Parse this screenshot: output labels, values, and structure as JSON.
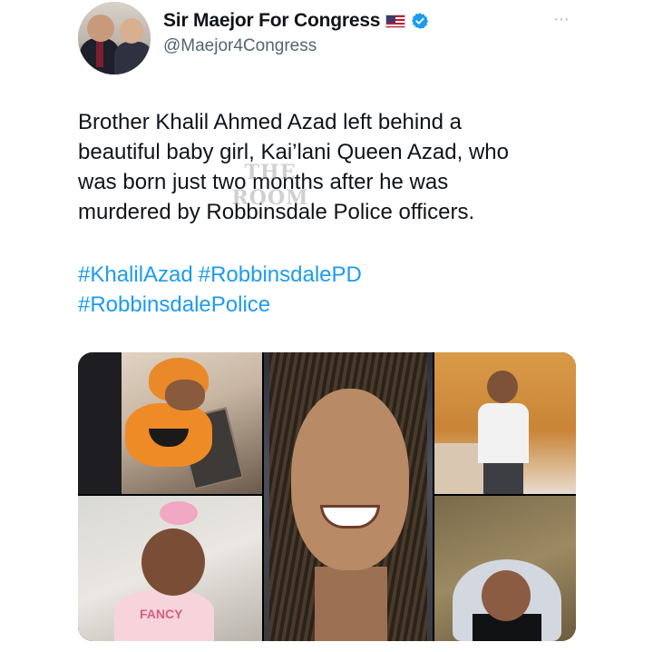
{
  "tweet": {
    "author": {
      "display_name": "Sir Maejor For Congress",
      "handle": "@Maejor4Congress",
      "flag_icon": "us-flag-icon",
      "verified_icon": "verified-badge-icon",
      "verified_color": "#1d9bf0"
    },
    "more_label": "···",
    "text": "Brother Khalil Ahmed Azad left behind a beautiful baby girl, Kai’lani Queen Azad, who was born just two months after he was murdered by Robbinsdale Police officers.",
    "watermark": {
      "line1": "THE",
      "line2": "ROOM"
    },
    "hashtags": [
      "#KhalilAzad",
      "#RobbinsdalePD",
      "#RobbinsdalePolice"
    ],
    "hashtag_color": "#1d9bf0",
    "media": {
      "photo_count": 5,
      "bib_text": "FANCY"
    }
  }
}
